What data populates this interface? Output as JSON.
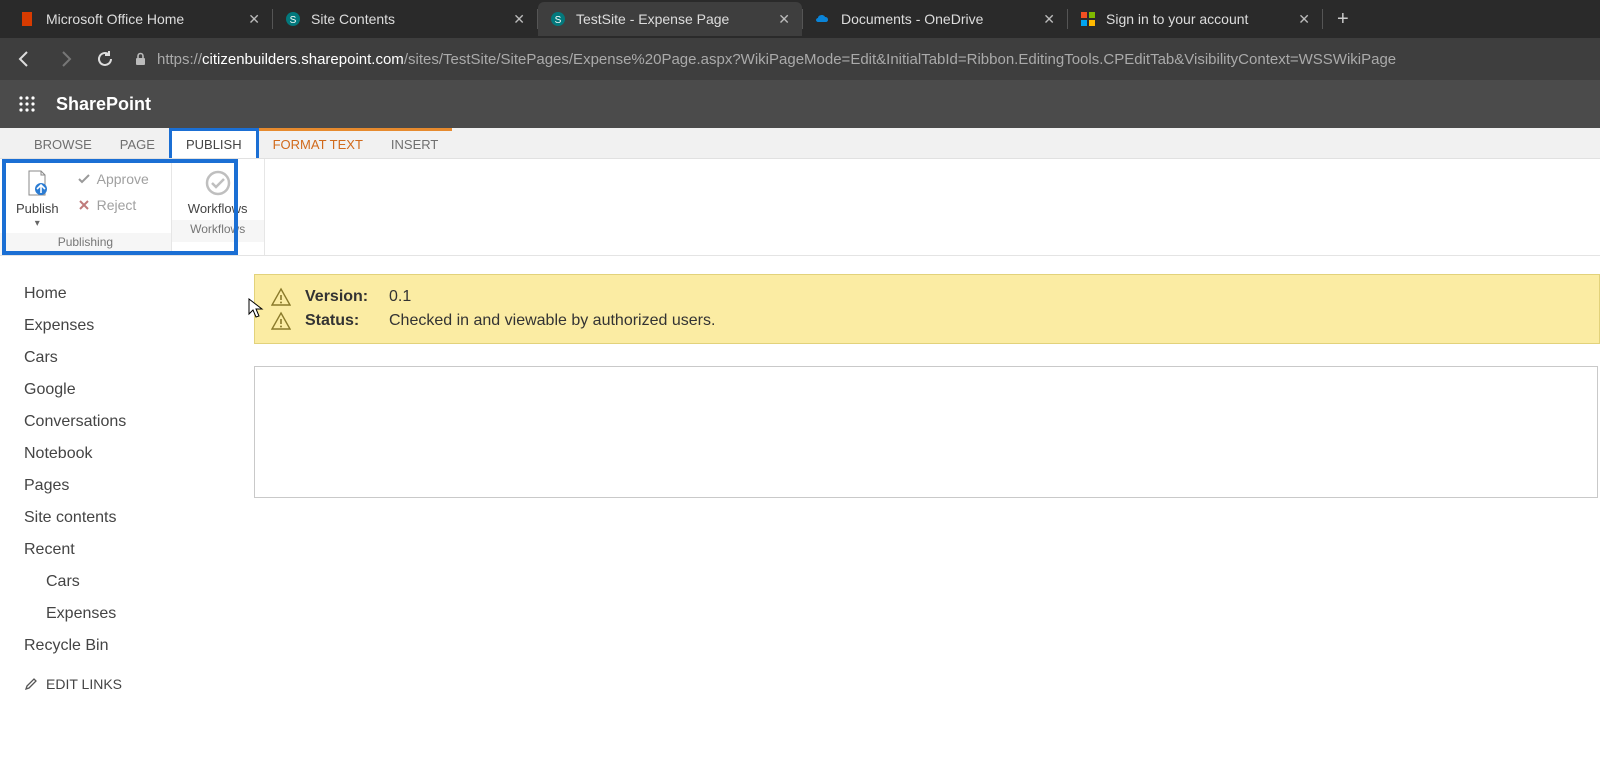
{
  "browser": {
    "tabs": [
      {
        "title": "Microsoft Office Home"
      },
      {
        "title": "Site Contents"
      },
      {
        "title": "TestSite - Expense Page"
      },
      {
        "title": "Documents - OneDrive"
      },
      {
        "title": "Sign in to your account"
      }
    ],
    "url_host": "citizenbuilders.sharepoint.com",
    "url_path": "/sites/TestSite/SitePages/Expense%20Page.aspx?WikiPageMode=Edit&InitialTabId=Ribbon.EditingTools.CPEditTab&VisibilityContext=WSSWikiPage",
    "url_scheme": "https://"
  },
  "suite": {
    "title": "SharePoint"
  },
  "ribbon": {
    "tabs": {
      "browse": "BROWSE",
      "page": "PAGE",
      "publish": "PUBLISH",
      "format_text": "FORMAT TEXT",
      "insert": "INSERT"
    },
    "groups": {
      "publishing": {
        "label": "Publishing",
        "publish": "Publish",
        "approve": "Approve",
        "reject": "Reject"
      },
      "workflows": {
        "label": "Workflows",
        "workflows": "Workflows"
      }
    }
  },
  "leftnav": {
    "items": [
      "Home",
      "Expenses",
      "Cars",
      "Google",
      "Conversations",
      "Notebook",
      "Pages",
      "Site contents",
      "Recent"
    ],
    "recent": [
      "Cars",
      "Expenses"
    ],
    "recycle": "Recycle Bin",
    "edit_links": "EDIT LINKS"
  },
  "status": {
    "version_label": "Version:",
    "version_value": "0.1",
    "status_label": "Status:",
    "status_value": "Checked in and viewable by authorized users."
  }
}
